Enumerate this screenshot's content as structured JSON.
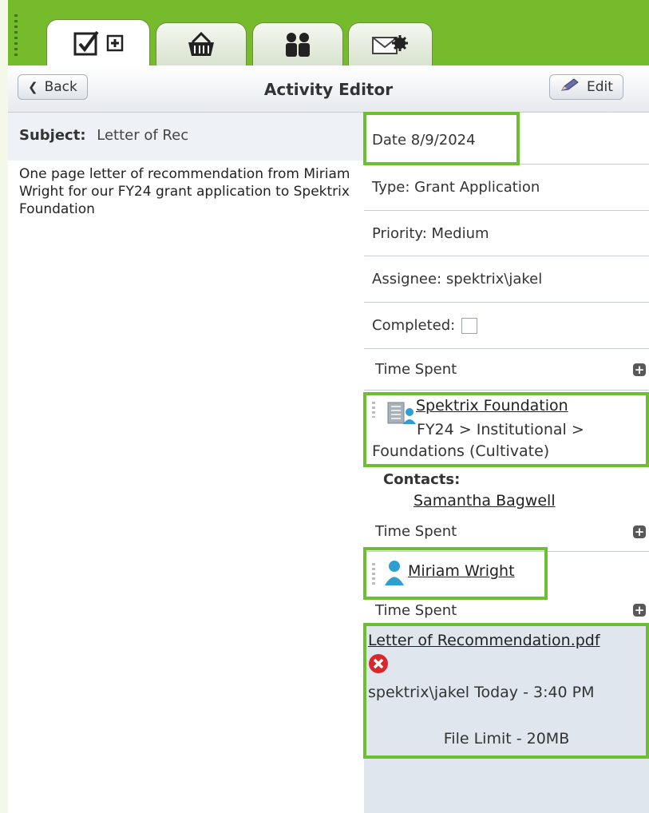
{
  "tabs": [
    {
      "icon": "checkbox-plus-icon"
    },
    {
      "icon": "basket-icon"
    },
    {
      "icon": "people-icon"
    },
    {
      "icon": "mail-gear-icon"
    }
  ],
  "header": {
    "back_label": "Back",
    "title": "Activity Editor",
    "edit_label": "Edit"
  },
  "subject": {
    "label": "Subject:",
    "value": "Letter of Rec"
  },
  "description": "One page letter of recommendation from Miriam Wright for our FY24 grant application to Spektrix Foundation",
  "details": {
    "date": "Date 8/9/2024",
    "type": "Type: Grant Application",
    "priority": "Priority: Medium",
    "assignee": "Assignee: spektrix\\jakel",
    "completed_label": "Completed:",
    "time_spent_1": "Time Spent",
    "org_name": "Spektrix Foundation",
    "org_path": "FY24 > Institutional > Foundations (Cultivate)",
    "contacts_label": "Contacts:",
    "contact_name": "Samantha Bagwell",
    "time_spent_2": "Time Spent",
    "person_name": "Miriam Wright",
    "time_spent_3": "Time Spent"
  },
  "file": {
    "name": "Letter of Recommendation.pdf",
    "meta": "spektrix\\jakel Today - 3:40 PM",
    "limit": "File Limit - 20MB"
  },
  "colors": {
    "topbar": "#76bb2b",
    "highlight": "#6cbf2f",
    "file_bg": "#dfe6ee"
  }
}
